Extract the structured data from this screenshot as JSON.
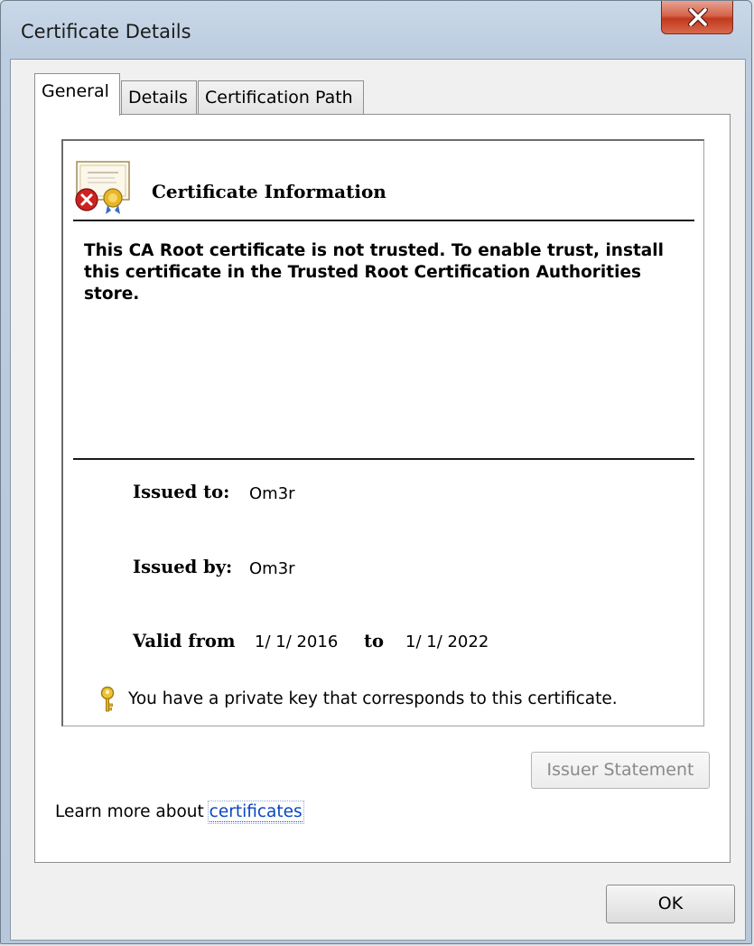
{
  "window": {
    "title": "Certificate Details"
  },
  "tabs": [
    {
      "label": "General"
    },
    {
      "label": "Details"
    },
    {
      "label": "Certification Path"
    }
  ],
  "general": {
    "info_title": "Certificate Information",
    "warning": "This CA Root certificate is not trusted. To enable trust, install this certificate in the Trusted Root Certification Authorities store.",
    "issued_to_label": "Issued to:",
    "issued_to_value": "Om3r",
    "issued_by_label": "Issued by:",
    "issued_by_value": "Om3r",
    "valid_from_label": "Valid from",
    "valid_from_value": "1/ 1/ 2016",
    "valid_to_label": "to",
    "valid_to_value": "1/ 1/ 2022",
    "private_key_text": "You have a private key that corresponds to this certificate."
  },
  "buttons": {
    "issuer_statement": "Issuer Statement",
    "ok": "OK"
  },
  "learn_more": {
    "prefix": "Learn more about ",
    "link": "certificates"
  },
  "colors": {
    "link": "#0a46c4",
    "close_button": "#c2391d"
  }
}
